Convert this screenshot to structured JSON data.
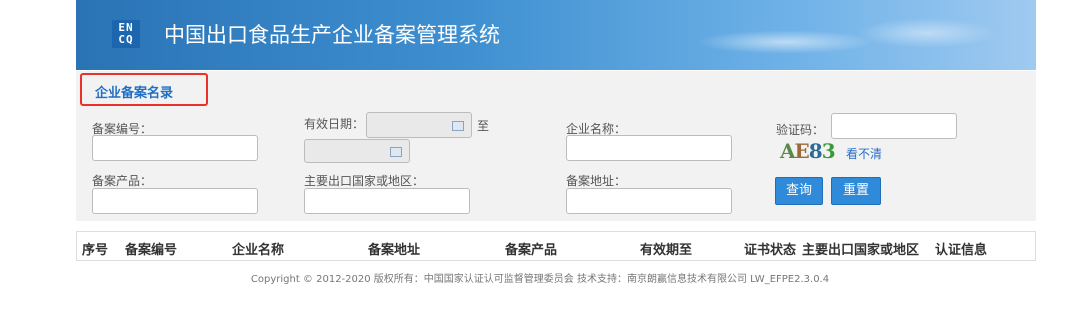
{
  "header": {
    "logo_text": "ENCQ",
    "title": "中国出口食品生产企业备案管理系统"
  },
  "tab": {
    "label": "企业备案名录"
  },
  "form": {
    "record_no_label": "备案编号：",
    "valid_date_label": "有效日期：",
    "to_label": "至",
    "company_name_label": "企业名称：",
    "captcha_label": "验证码：",
    "product_label": "备案产品：",
    "country_label": "主要出口国家或地区：",
    "address_label": "备案地址：",
    "captcha_chars": [
      "A",
      "E",
      "8",
      "3"
    ],
    "refresh_text": "看不清",
    "search_button": "查询",
    "reset_button": "重置"
  },
  "table": {
    "headers": [
      "序号",
      "备案编号",
      "企业名称",
      "备案地址",
      "备案产品",
      "有效期至",
      "证书状态",
      "主要出口国家或地区",
      "认证信息"
    ]
  },
  "footer": {
    "text": "Copyright © 2012-2020 版权所有：中国国家认证认可监督管理委员会 技术支持：南京朗赢信息技术有限公司 LW_EFPE2.3.0.4"
  },
  "colors": {
    "header_blue": "#2a73b5",
    "tab_border": "#e8332a",
    "tab_text": "#1f6fc4",
    "button_blue": "#2f8ad9"
  }
}
